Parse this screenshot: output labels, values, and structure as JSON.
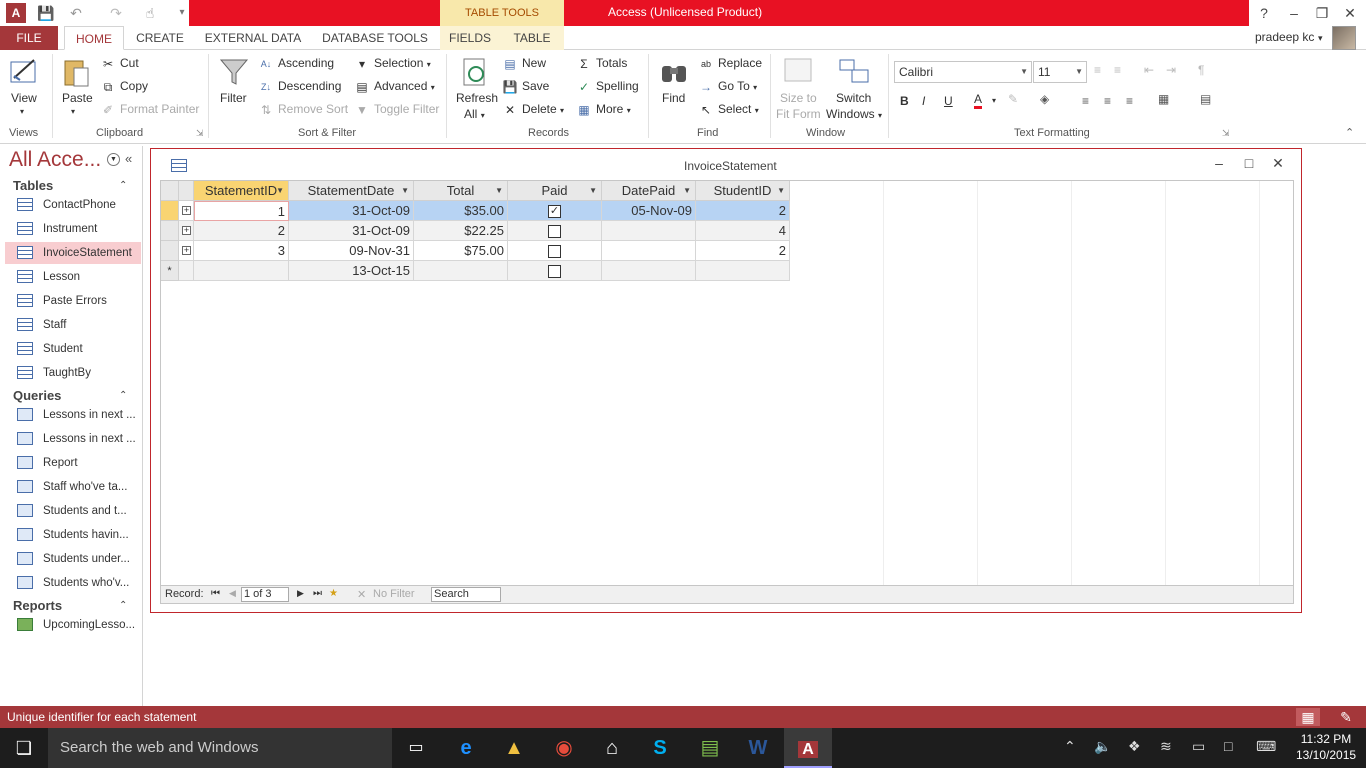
{
  "window": {
    "title": "Access (Unlicensed Product)",
    "context_tab": "TABLE TOOLS",
    "app_icon": "A"
  },
  "ribbon_tabs": {
    "file": "FILE",
    "home": "HOME",
    "create": "CREATE",
    "external": "EXTERNAL DATA",
    "dbtools": "DATABASE TOOLS",
    "fields": "FIELDS",
    "table": "TABLE"
  },
  "user": {
    "name": "pradeep kc",
    "help": "?"
  },
  "ribbon": {
    "views": {
      "label": "Views",
      "view": "View"
    },
    "clipboard": {
      "label": "Clipboard",
      "paste": "Paste",
      "cut": "Cut",
      "copy": "Copy",
      "format_painter": "Format Painter"
    },
    "sortfilter": {
      "label": "Sort & Filter",
      "filter": "Filter",
      "ascending": "Ascending",
      "descending": "Descending",
      "remove_sort": "Remove Sort",
      "selection": "Selection",
      "advanced": "Advanced",
      "toggle_filter": "Toggle Filter"
    },
    "records": {
      "label": "Records",
      "refresh": "Refresh",
      "refresh2": "All",
      "new": "New",
      "save": "Save",
      "delete": "Delete",
      "totals": "Totals",
      "spelling": "Spelling",
      "more": "More"
    },
    "find": {
      "label": "Find",
      "find": "Find",
      "replace": "Replace",
      "goto": "Go To",
      "select": "Select"
    },
    "window": {
      "label": "Window",
      "size_to_fit": "Size to",
      "size_to_fit2": "Fit Form",
      "switch": "Switch",
      "switch2": "Windows"
    },
    "text_formatting": {
      "label": "Text Formatting",
      "font": "Calibri",
      "size": "11",
      "bold": "B",
      "italic": "I",
      "underline": "U",
      "font_color": "A"
    }
  },
  "nav": {
    "title": "All Acce...",
    "sections": {
      "tables": "Tables",
      "queries": "Queries",
      "reports": "Reports"
    },
    "tables": [
      "ContactPhone",
      "Instrument",
      "InvoiceStatement",
      "Lesson",
      "Paste Errors",
      "Staff",
      "Student",
      "TaughtBy"
    ],
    "queries": [
      "Lessons in next ...",
      "Lessons in next ...",
      "Report",
      "Staff who've ta...",
      "Students and t...",
      "Students havin...",
      "Students under...",
      "Students who'v..."
    ],
    "reports": [
      "UpcomingLesso..."
    ]
  },
  "document": {
    "title": "InvoiceStatement",
    "columns": [
      "StatementID",
      "StatementDate",
      "Total",
      "Paid",
      "DatePaid",
      "StudentID"
    ],
    "rows": [
      {
        "id": "1",
        "date": "31-Oct-09",
        "total": "$35.00",
        "paid": true,
        "date_paid": "05-Nov-09",
        "student": "2"
      },
      {
        "id": "2",
        "date": "31-Oct-09",
        "total": "$22.25",
        "paid": false,
        "date_paid": "",
        "student": "4"
      },
      {
        "id": "3",
        "date": "09-Nov-31",
        "total": "$75.00",
        "paid": false,
        "date_paid": "",
        "student": "2"
      }
    ],
    "new_row": {
      "date": "13-Oct-15",
      "selector": "*"
    }
  },
  "record_nav": {
    "label": "Record:",
    "position": "1 of 3",
    "no_filter": "No Filter",
    "search": "Search"
  },
  "status": {
    "text": "Unique identifier for each statement"
  },
  "taskbar": {
    "search_placeholder": "Search the web and Windows",
    "time": "11:32 PM",
    "date": "13/10/2015"
  },
  "colors": {
    "accent": "#a4373a",
    "title_red": "#e81123",
    "selection": "#b7d3f3",
    "header_highlight": "#f9d472"
  }
}
